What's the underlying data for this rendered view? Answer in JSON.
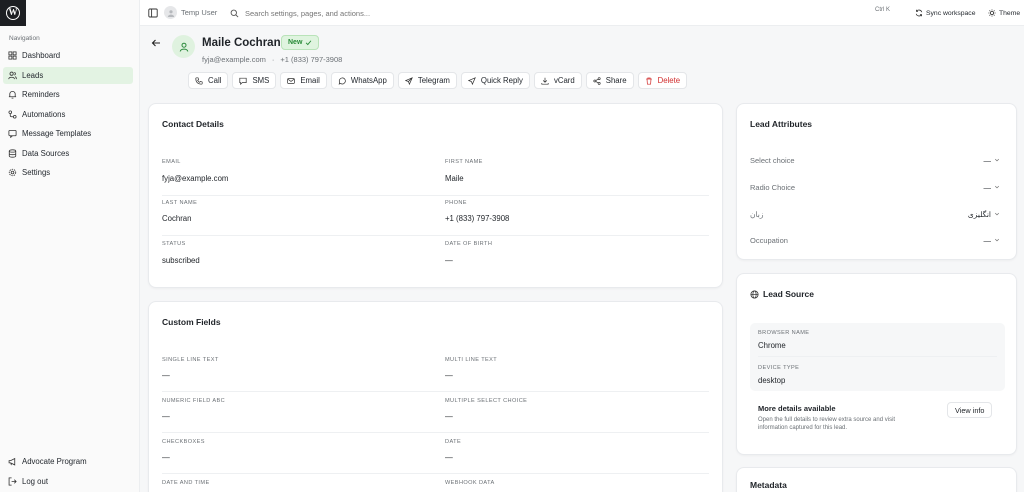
{
  "sidebar": {
    "heading": "Navigation",
    "items": [
      {
        "label": "Dashboard",
        "icon": "dashboard-icon"
      },
      {
        "label": "Leads",
        "icon": "users-icon",
        "active": true
      },
      {
        "label": "Reminders",
        "icon": "bell-icon"
      },
      {
        "label": "Automations",
        "icon": "automation-icon"
      },
      {
        "label": "Message Templates",
        "icon": "template-icon"
      },
      {
        "label": "Data Sources",
        "icon": "database-icon"
      },
      {
        "label": "Settings",
        "icon": "gear-icon"
      }
    ],
    "bottom": [
      {
        "label": "Advocate Program",
        "icon": "megaphone-icon"
      },
      {
        "label": "Log out",
        "icon": "logout-icon"
      }
    ]
  },
  "topbar": {
    "user": "Temp User",
    "search_placeholder": "Search settings, pages, and actions...",
    "shortcut": "Ctrl K",
    "sync_label": "Sync workspace",
    "theme_label": "Theme"
  },
  "lead": {
    "name": "Maile Cochran",
    "status_badge": "New",
    "email": "fyja@example.com",
    "separator": "·",
    "phone": "+1 (833) 797-3908"
  },
  "actions": [
    {
      "label": "Call",
      "icon": "phone-icon"
    },
    {
      "label": "SMS",
      "icon": "message-icon"
    },
    {
      "label": "Email",
      "icon": "mail-icon"
    },
    {
      "label": "WhatsApp",
      "icon": "whatsapp-icon"
    },
    {
      "label": "Telegram",
      "icon": "send-icon"
    },
    {
      "label": "Quick Reply",
      "icon": "quick-reply-icon"
    },
    {
      "label": "vCard",
      "icon": "download-icon"
    },
    {
      "label": "Share",
      "icon": "share-icon"
    },
    {
      "label": "Delete",
      "icon": "trash-icon",
      "danger": true
    }
  ],
  "contact": {
    "title": "Contact Details",
    "fields": [
      {
        "label": "Email",
        "value": "fyja@example.com"
      },
      {
        "label": "First Name",
        "value": "Maile"
      },
      {
        "label": "Last Name",
        "value": "Cochran"
      },
      {
        "label": "Phone",
        "value": "+1 (833) 797-3908"
      },
      {
        "label": "Status",
        "value": "subscribed"
      },
      {
        "label": "Date of Birth",
        "value": "—"
      }
    ]
  },
  "custom": {
    "title": "Custom Fields",
    "fields": [
      {
        "label": "Single Line Text",
        "value": "—"
      },
      {
        "label": "Multi Line Text",
        "value": "—"
      },
      {
        "label": "Numeric Field ABC",
        "value": "—"
      },
      {
        "label": "Multiple Select Choice",
        "value": "—"
      },
      {
        "label": "Checkboxes",
        "value": "—"
      },
      {
        "label": "Date",
        "value": "—"
      },
      {
        "label": "Date and Time",
        "value": ""
      },
      {
        "label": "Webhook Data",
        "value": ""
      }
    ]
  },
  "attributes": {
    "title": "Lead Attributes",
    "rows": [
      {
        "label": "Select choice",
        "value": "—"
      },
      {
        "label": "Radio Choice",
        "value": "—"
      },
      {
        "label": "زبان",
        "value": "انگلیزی"
      },
      {
        "label": "Occupation",
        "value": "—"
      }
    ]
  },
  "source": {
    "title": "Lead Source",
    "browser_label": "Browser Name",
    "browser_value": "Chrome",
    "device_label": "Device Type",
    "device_value": "desktop",
    "more_title": "More details available",
    "more_desc": "Open the full details to review extra source and visit information captured for this lead.",
    "view_info": "View info"
  },
  "metadata": {
    "title": "Metadata"
  },
  "colors": {
    "accent": "#268a36",
    "active_bg": "#e3f3e3",
    "danger": "#d12e2e"
  }
}
